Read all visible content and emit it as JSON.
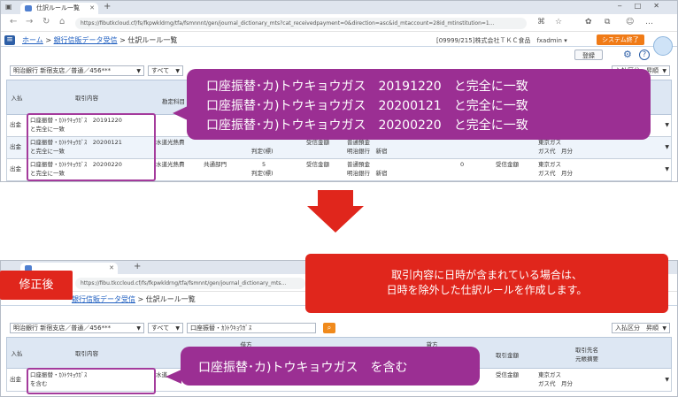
{
  "browser": {
    "tab_title": "仕訳ルール一覧",
    "new_tab": "+",
    "url": "https://fibutkcloud.cf/fs/fkpwkldrng/tfa/fsmnnnt/gen/journal_dictionary_mts?cat_receivedpayment=0&direction=asc&id_mtaccount=28id_mtinstitution=1...",
    "url_short": "https://fibu.tkccloud.cf/fs/fkpwkldrng/tfa/fsmnnt/gen/journal_dictionary_mts..."
  },
  "app": {
    "breadcrumb_home": "ホーム",
    "breadcrumb_sep": ">",
    "breadcrumb_bank": "銀行信販データ受信",
    "breadcrumb_current": "仕訳ルール一覧",
    "company": "[09999/215]株式会社ＴＫＣ食品　fxadmin ▾",
    "system_end": "システム終了",
    "register_button": "登録"
  },
  "filters": {
    "account": "明治銀行 新宿支店／普通／456***",
    "all": "すべて",
    "keyword": "口座振替・ｶ)ﾄｳｷｮｳｶﾞｽ",
    "entry_type": "入払区分　昇順"
  },
  "grid_headers": {
    "in_out": "入払",
    "content": "取引内容",
    "debit": "借方",
    "credit": "貸方",
    "amount": "取引金額",
    "debit_sub": "勘定科目",
    "partner": "取引先名\n元帳摘要"
  },
  "top_rows": [
    {
      "type": "出金",
      "content1": "口座振替・ｶ)ﾄｳｷｮｳｶﾞｽ　20191220",
      "content2": "と完全に一致",
      "account": "水道光熱費",
      "dept": "",
      "tax": "",
      "amount_label": "",
      "bank1": "",
      "bank2": "",
      "zero": "",
      "recv": "",
      "partner1": "",
      "partner2": ""
    },
    {
      "type": "出金",
      "content1": "口座振替・ｶ)ﾄｳｷｮｳｶﾞｽ　20200121",
      "content2": "と完全に一致",
      "account": "水道光熱費",
      "dept": "共通部門",
      "tax": "判定(標)",
      "amount_label": "受信金額",
      "bank1": "普通預金",
      "bank2": "明治銀行　新宿",
      "zero": "0",
      "recv": "受信金額",
      "partner1": "東京ガス",
      "partner2": "ガス代　月分"
    },
    {
      "type": "出金",
      "content1": "口座振替・ｶ)ﾄｳｷｮｳｶﾞｽ　20200220",
      "content2": "と完全に一致",
      "account": "水道光熱費",
      "dept": "共通部門",
      "tax_num": "5",
      "tax": "判定(標)",
      "amount_label": "受信金額",
      "bank1": "普通預金",
      "bank2": "明治銀行　新宿",
      "zero": "0",
      "recv": "受信金額",
      "partner1": "東京ガス",
      "partner2": "ガス代　月分"
    }
  ],
  "callout_top": [
    "口座振替･カ)トウキョウガス　20191220　と完全に一致",
    "口座振替･カ)トウキョウガス　20200121　と完全に一致",
    "口座振替･カ)トウキョウガス　20200220　と完全に一致"
  ],
  "label_after": "修正後",
  "note_box": [
    "取引内容に日時が含まれている場合は、",
    "日時を除外した仕訳ルールを作成します。"
  ],
  "bottom_row": {
    "type": "出金",
    "content1": "口座振替・ｶ)ﾄｳｷｮｳｶﾞｽ",
    "content2": "を含む",
    "account": "水道",
    "recv": "受信金額",
    "partner1": "東京ガス",
    "partner2": "ガス代　月分"
  },
  "callout_bottom": "口座振替･カ)トウキョウガス　を含む",
  "colors": {
    "accent_purple": "#9b2f93",
    "red": "#e0261c",
    "orange": "#f07b17",
    "link": "#1f5fc0"
  }
}
